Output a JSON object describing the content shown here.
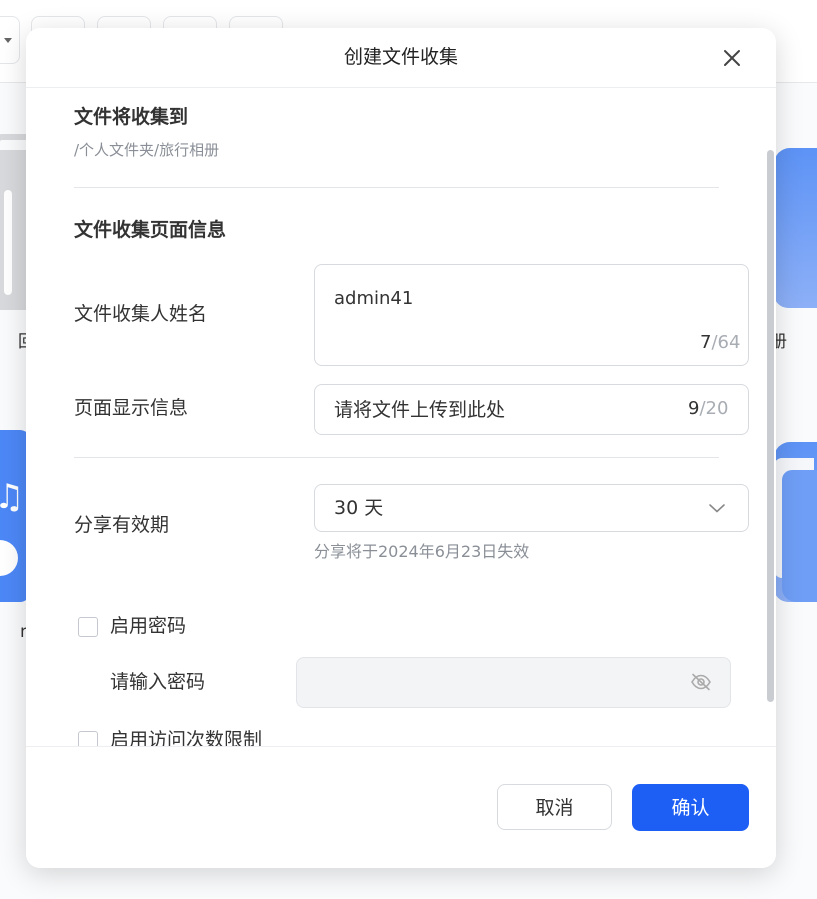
{
  "background": {
    "left_fragments": [
      "回",
      "n"
    ],
    "right_fragment": "册"
  },
  "dialog": {
    "title": "创建文件收集",
    "close_icon": "close-icon",
    "destination": {
      "title": "文件将收集到",
      "path": "/个人文件夹/旅行相册"
    },
    "page_info": {
      "title": "文件收集页面信息",
      "collector_name": {
        "label": "文件收集人姓名",
        "value": "admin41",
        "count": "7",
        "max": "/64"
      },
      "display_message": {
        "label": "页面显示信息",
        "value": "请将文件上传到此处",
        "count": "9",
        "max": "/20"
      }
    },
    "validity": {
      "label": "分享有效期",
      "selected": "30 天",
      "hint": "分享将于2024年6月23日失效",
      "icon": "chevron-down-icon"
    },
    "password": {
      "checkbox_label": "启用密码",
      "checked": false,
      "label": "请输入密码",
      "value": "",
      "icon": "eye-slash-icon"
    },
    "visit_limit": {
      "checkbox_label": "启用访问次数限制",
      "checked": false
    },
    "footer": {
      "cancel_label": "取消",
      "confirm_label": "确认"
    },
    "colors": {
      "primary": "#1d5ff5",
      "border": "#d7dade",
      "muted_text": "#8a8f97"
    }
  }
}
